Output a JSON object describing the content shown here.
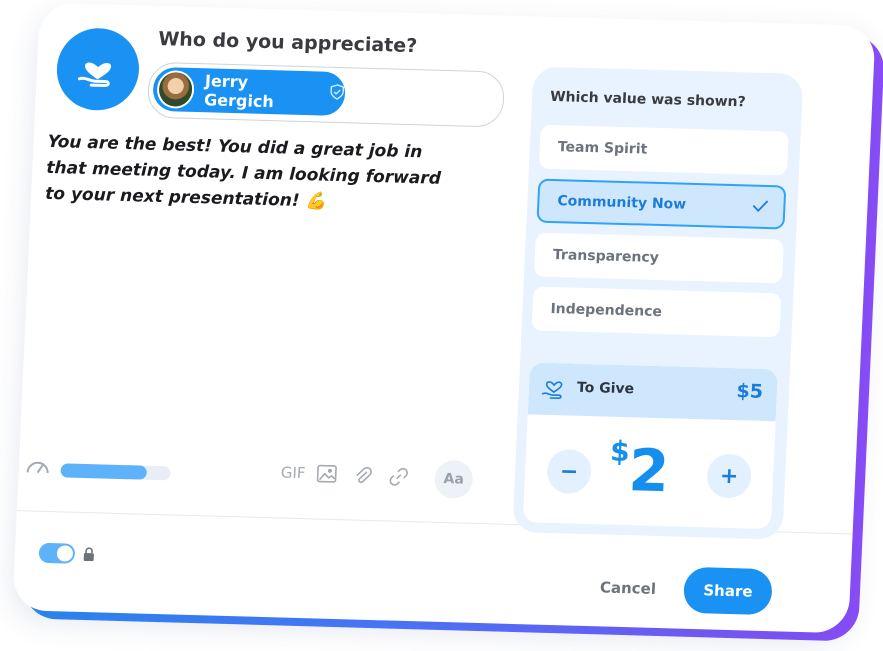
{
  "composer": {
    "question": "Who do you appreciate?",
    "recipient": {
      "name": "Jerry Gergich"
    },
    "message": "You are the best! You did a great job in that meeting today. I am looking forward to your next presentation! 💪",
    "progress_fraction": 0.78,
    "tools": {
      "gif": "GIF",
      "font": "Aa"
    }
  },
  "values_panel": {
    "title": "Which value was shown?",
    "options": [
      {
        "label": "Team Spirit"
      },
      {
        "label": "Community Now",
        "selected": true
      },
      {
        "label": "Transparency"
      },
      {
        "label": "Independence"
      }
    ]
  },
  "give": {
    "label": "To Give",
    "budget": "$5",
    "currency": "$",
    "amount": "2",
    "minus": "−",
    "plus": "+"
  },
  "footer": {
    "cancel": "Cancel",
    "share": "Share"
  },
  "colors": {
    "accent": "#1992f3",
    "panel_bg": "#e8f3ff",
    "gradient_start": "#2b8af7",
    "gradient_end": "#8c4dfb"
  },
  "icons": {
    "header": "heart-hand-icon",
    "verify": "shield-check-icon",
    "gauge": "gauge-icon",
    "image": "image-icon",
    "attachment": "paperclip-icon",
    "link": "link-icon",
    "selected": "check-icon",
    "give": "heart-hand-icon",
    "privacy": "lock-icon"
  }
}
